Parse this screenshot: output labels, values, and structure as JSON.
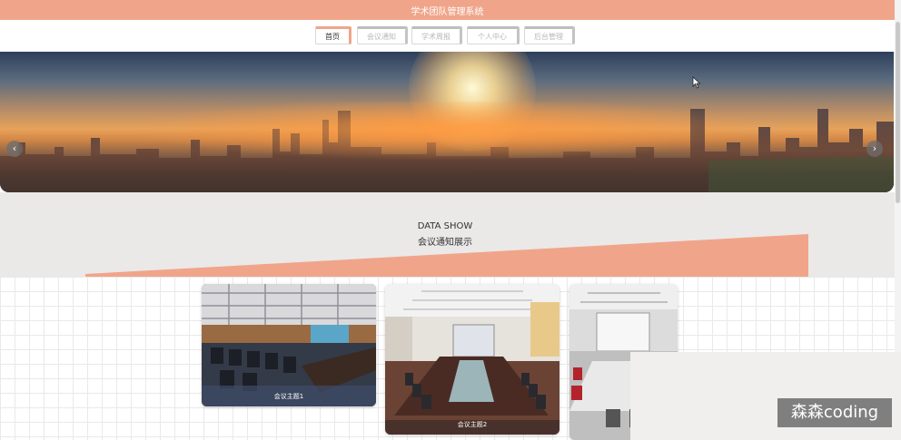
{
  "app": {
    "title": "学术团队管理系统"
  },
  "nav": {
    "tabs": [
      {
        "label": "首页",
        "active": true
      },
      {
        "label": "会议通知",
        "active": false
      },
      {
        "label": "学术周报",
        "active": false
      },
      {
        "label": "个人中心",
        "active": false
      },
      {
        "label": "后台管理",
        "active": false
      }
    ]
  },
  "carousel": {
    "prev_icon": "chevron-left-icon",
    "next_icon": "chevron-right-icon"
  },
  "section": {
    "title": "DATA SHOW",
    "subtitle": "会议通知展示"
  },
  "cards": [
    {
      "caption": "会议主题1"
    },
    {
      "caption": "会议主题2"
    },
    {
      "caption": ""
    }
  ],
  "watermark": {
    "text": "森森coding"
  },
  "colors": {
    "accent": "#f0a58a",
    "section_bg": "#ebe8e8"
  }
}
